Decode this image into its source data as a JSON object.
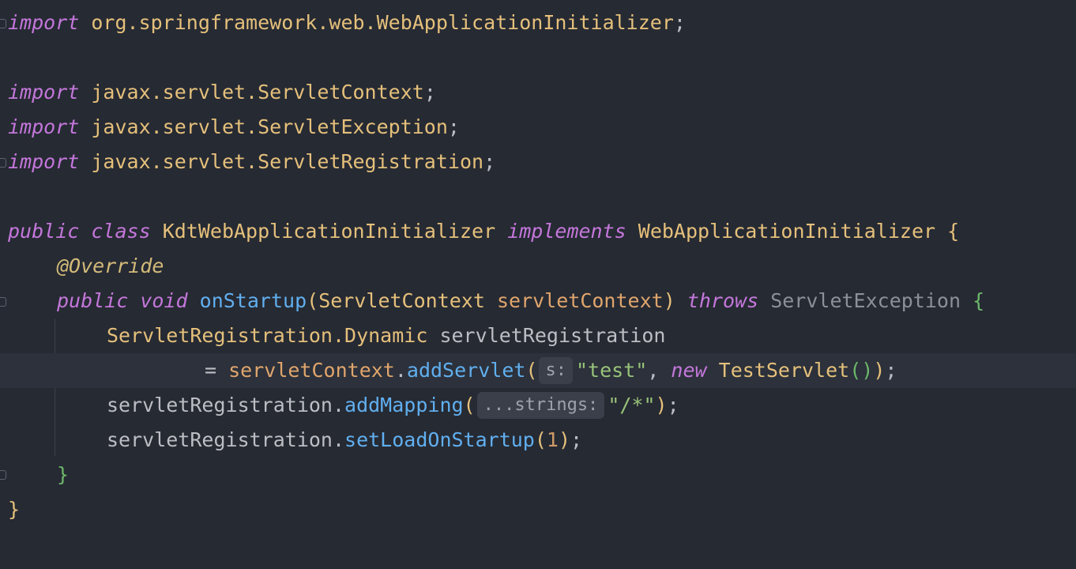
{
  "editor": {
    "lines": [
      {
        "kw_import": "import",
        "pkg": "org.springframework.web.WebApplicationInitializer",
        "semi": ";"
      },
      {
        "kw_import": "import",
        "pkg": "javax.servlet.ServletContext",
        "semi": ";"
      },
      {
        "kw_import": "import",
        "pkg": "javax.servlet.ServletException",
        "semi": ";"
      },
      {
        "kw_import": "import",
        "pkg": "javax.servlet.ServletRegistration",
        "semi": ";"
      }
    ],
    "class_decl": {
      "kw_public": "public",
      "kw_class": "class",
      "name": "KdtWebApplicationInitializer",
      "kw_implements": "implements",
      "iface": "WebApplicationInitializer",
      "brace": "{"
    },
    "annotation": "@Override",
    "method_decl": {
      "kw_public": "public",
      "kw_void": "void",
      "name": "onStartup",
      "lparen": "(",
      "param_type": "ServletContext",
      "param_name": "servletContext",
      "rparen": ")",
      "kw_throws": "throws",
      "exception": "ServletException",
      "brace": "{"
    },
    "stmt1": {
      "type": "ServletRegistration.Dynamic",
      "var": "servletRegistration"
    },
    "stmt1_cont": {
      "eq": "=",
      "recv": "servletContext",
      "dot": ".",
      "method": "addServlet",
      "lparen": "(",
      "hint": "s:",
      "arg_str": "\"test\"",
      "comma": ",",
      "kw_new": "new",
      "ctor": "TestServlet",
      "ctor_parens": "()",
      "rparen": ")",
      "semi": ";"
    },
    "stmt2": {
      "recv": "servletRegistration.",
      "method": "addMapping",
      "lparen": "(",
      "hint": "...strings:",
      "arg_str": "\"/*\"",
      "rparen": ")",
      "semi": ";"
    },
    "stmt3": {
      "recv": "servletRegistration.",
      "method": "setLoadOnStartup",
      "lparen": "(",
      "arg_num": "1",
      "rparen": ")",
      "semi": ";"
    },
    "method_close": "}",
    "class_close": "}"
  },
  "colors": {
    "background": "#262a33",
    "current_line": "#2c313b",
    "keyword": "#c477db",
    "identifier": "#e5c07b",
    "function": "#61afef",
    "string": "#98c379"
  }
}
